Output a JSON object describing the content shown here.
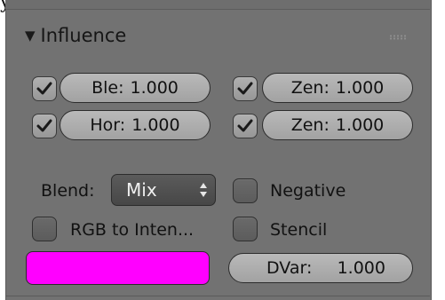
{
  "panel": {
    "header_title": "Influence",
    "top_fragment": "y"
  },
  "influence": [
    {
      "label": "Ble:",
      "value": "1.000",
      "checked": true
    },
    {
      "label": "Zen:",
      "value": "1.000",
      "checked": true
    },
    {
      "label": "Hor:",
      "value": "1.000",
      "checked": true
    },
    {
      "label": "Zen:",
      "value": "1.000",
      "checked": true
    }
  ],
  "blend": {
    "label": "Blend:",
    "selected": "Mix"
  },
  "options": {
    "negative": {
      "label": "Negative",
      "checked": false
    },
    "rgb_to_intensity": {
      "label": "RGB to Inten...",
      "checked": false
    },
    "stencil": {
      "label": "Stencil",
      "checked": false
    }
  },
  "color": {
    "value": "#ff00ff"
  },
  "dvar": {
    "label": "DVar:",
    "value": "1.000"
  },
  "theme": {
    "panel_bg": "#727272",
    "field_bg": "#aeaeae",
    "outline": "#2c2c2c",
    "checkmark": "#1a1a1a"
  }
}
